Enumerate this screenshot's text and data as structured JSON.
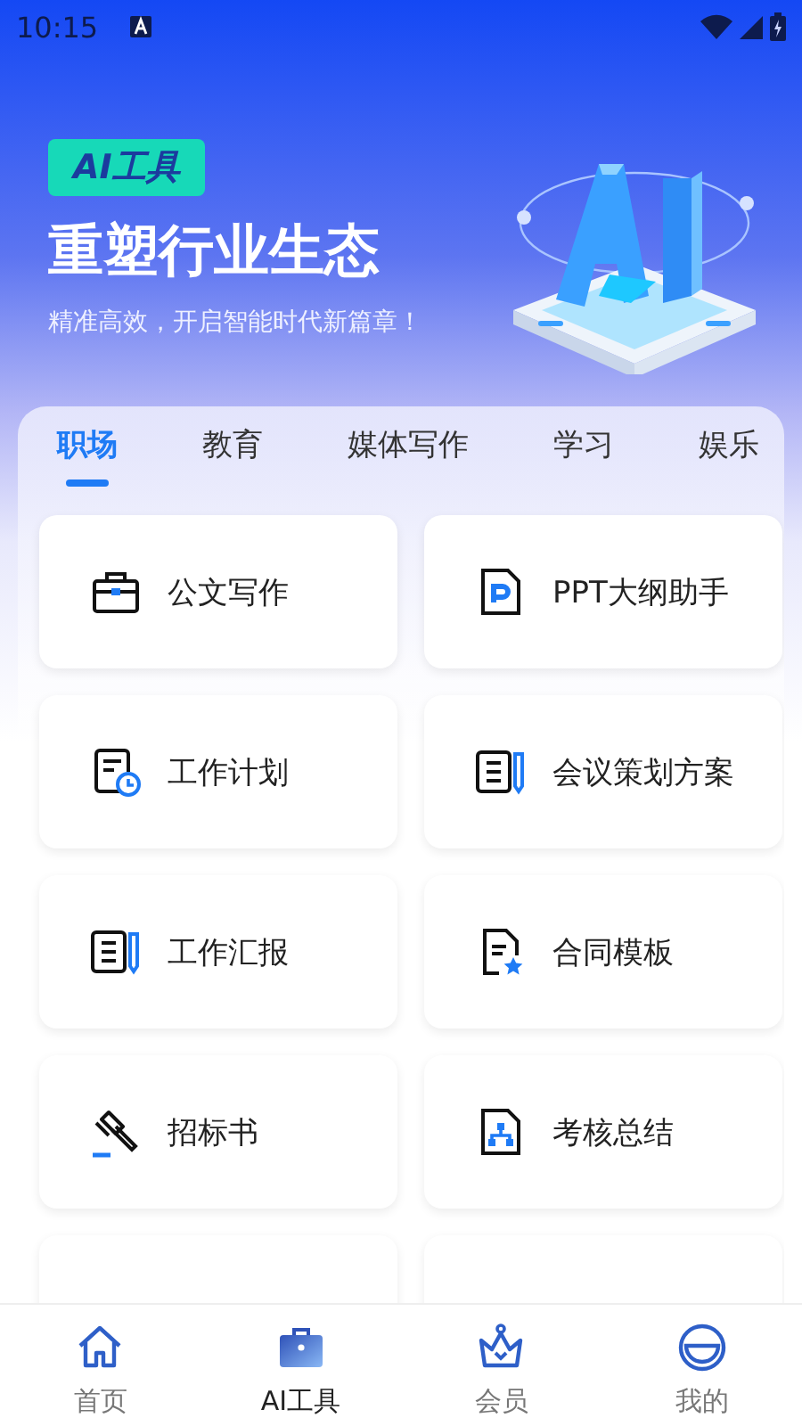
{
  "status_bar": {
    "time": "10:15"
  },
  "hero": {
    "badge": "AI工具",
    "title": "重塑行业生态",
    "subtitle": "精准高效，开启智能时代新篇章！"
  },
  "tabs": [
    {
      "label": "职场",
      "selected": true
    },
    {
      "label": "教育",
      "selected": false
    },
    {
      "label": "媒体写作",
      "selected": false
    },
    {
      "label": "学习",
      "selected": false
    },
    {
      "label": "娱乐",
      "selected": false
    }
  ],
  "tools": [
    {
      "kind": "tool",
      "label": "公文写作"
    },
    {
      "kind": "tool",
      "label": "PPT大纲助手"
    },
    {
      "kind": "tool",
      "label": "工作计划"
    },
    {
      "kind": "tool",
      "label": "会议策划方案"
    },
    {
      "kind": "tool",
      "label": "工作汇报"
    },
    {
      "kind": "tool",
      "label": "合同模板"
    },
    {
      "kind": "tool",
      "label": "招标书"
    },
    {
      "kind": "tool",
      "label": "考核总结"
    },
    {
      "kind": "partial"
    },
    {
      "kind": "partial"
    }
  ],
  "bottom_nav": [
    {
      "label": "首页",
      "selected": false
    },
    {
      "label": "AI工具",
      "selected": true
    },
    {
      "label": "会员",
      "selected": false
    },
    {
      "label": "我的",
      "selected": false
    }
  ]
}
